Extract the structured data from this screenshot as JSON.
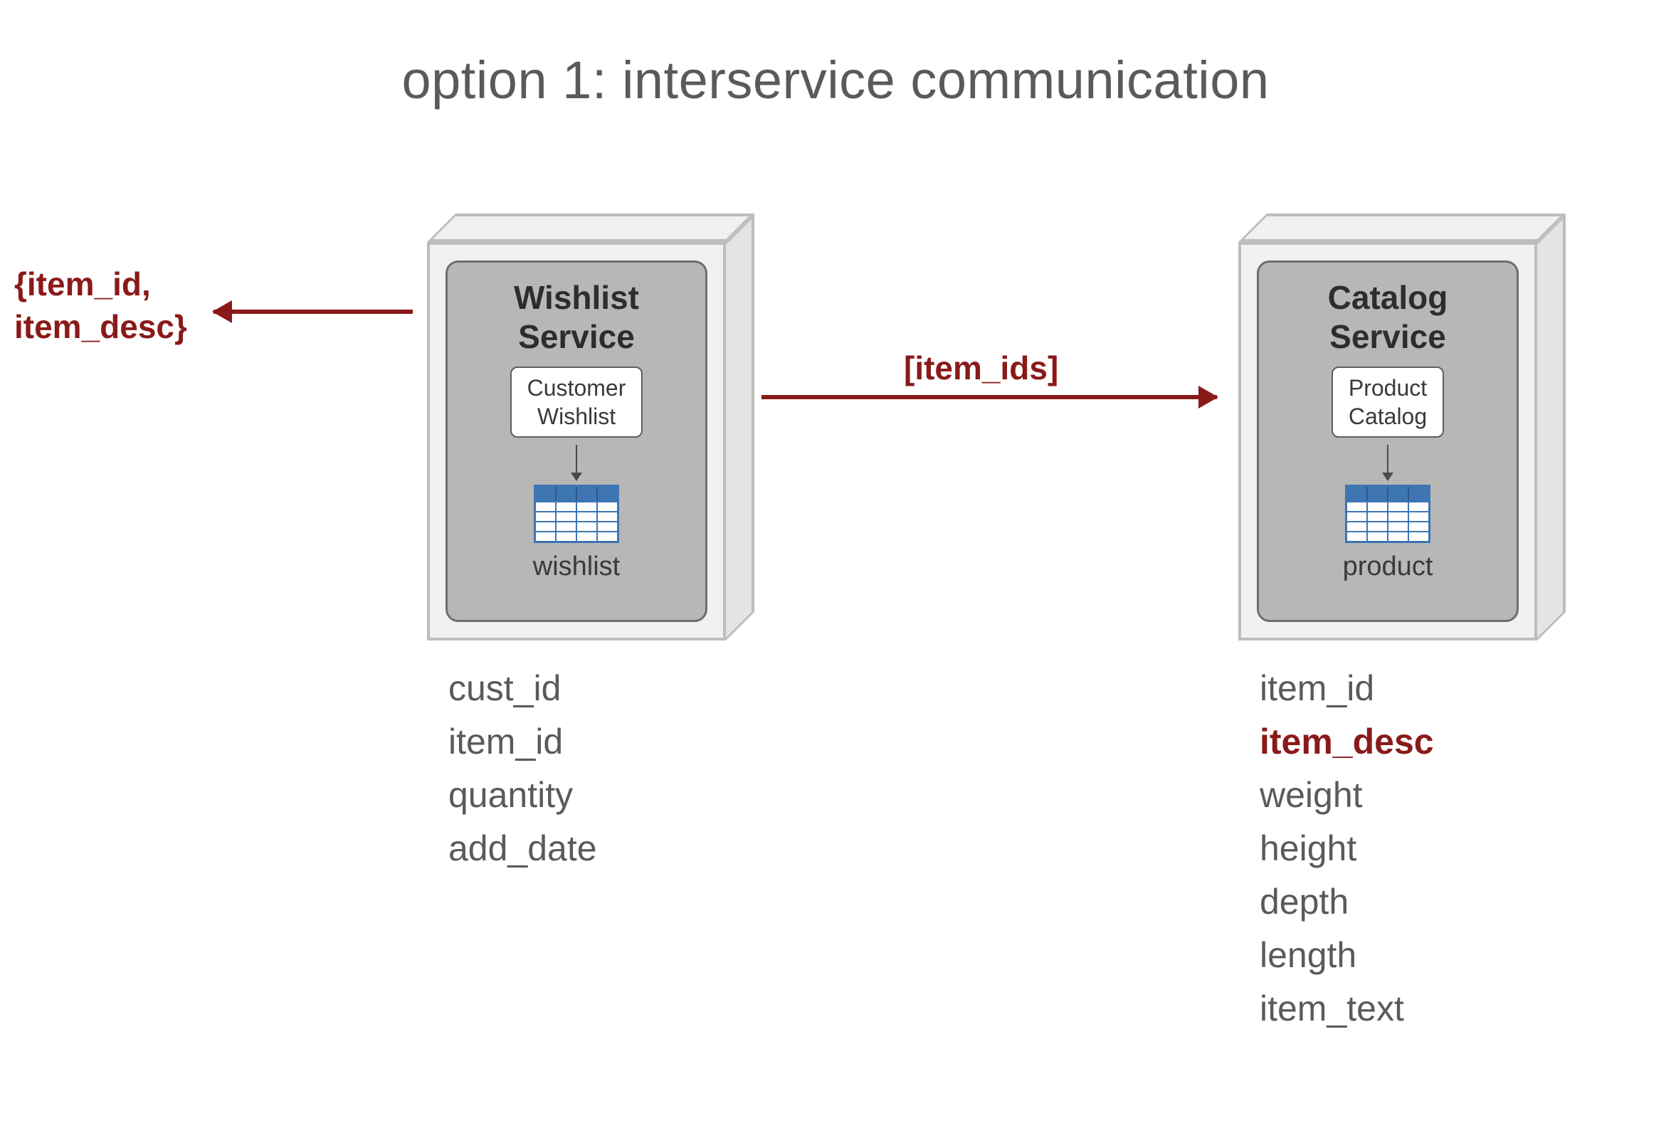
{
  "title": "option 1: interservice communication",
  "response_label_line1": "{item_id,",
  "response_label_line2": " item_desc}",
  "request_label": "[item_ids]",
  "services": {
    "wishlist": {
      "title_line1": "Wishlist",
      "title_line2": "Service",
      "component_line1": "Customer",
      "component_line2": "Wishlist",
      "table_name": "wishlist",
      "fields": [
        "cust_id",
        "item_id",
        "quantity",
        "add_date"
      ],
      "highlight_fields": []
    },
    "catalog": {
      "title_line1": "Catalog",
      "title_line2": "Service",
      "component_line1": "Product",
      "component_line2": "Catalog",
      "table_name": "product",
      "fields": [
        "item_id",
        "item_desc",
        "weight",
        "height",
        "depth",
        "length",
        "item_text"
      ],
      "highlight_fields": [
        "item_desc"
      ]
    }
  },
  "colors": {
    "accent": "#8a1a1a",
    "text": "#5a5a5a",
    "box_light": "#f1f1f0",
    "box_inner": "#b7b7b6",
    "table_blue": "#3e75b3"
  }
}
